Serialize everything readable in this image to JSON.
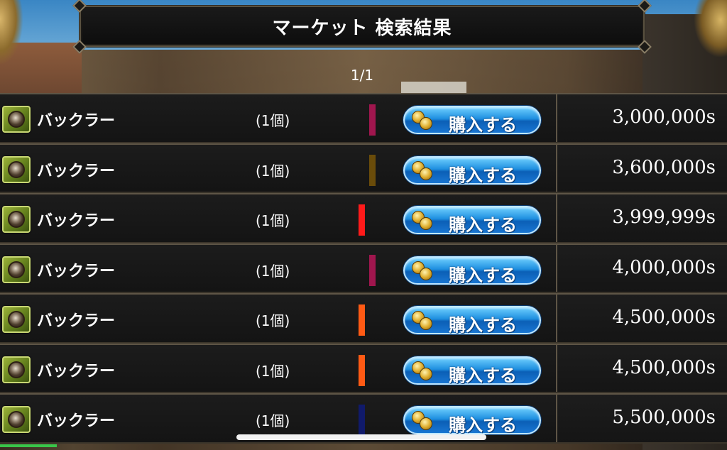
{
  "header": {
    "title": "マーケット  検索結果"
  },
  "pagination": {
    "label": "1/1"
  },
  "colors": {
    "buy_button": "#1f8fe0",
    "row_background": "#171717",
    "border": "#5e5546"
  },
  "listings": [
    {
      "icon": "buckler-shield-icon",
      "name": "バックラー",
      "quantity": "(1個)",
      "rarity_color": "#a0164e",
      "buy_label": "購入する",
      "price": "3,000,000s"
    },
    {
      "icon": "buckler-shield-icon",
      "name": "バックラー",
      "quantity": "(1個)",
      "rarity_color": "#6a4c0a",
      "buy_label": "購入する",
      "price": "3,600,000s"
    },
    {
      "icon": "buckler-shield-icon",
      "name": "バックラー",
      "quantity": "(1個)",
      "rarity_color": "#ff1a1a",
      "buy_label": "購入する",
      "price": "3,999,999s"
    },
    {
      "icon": "buckler-shield-icon",
      "name": "バックラー",
      "quantity": "(1個)",
      "rarity_color": "#a0164e",
      "buy_label": "購入する",
      "price": "4,000,000s"
    },
    {
      "icon": "buckler-shield-icon",
      "name": "バックラー",
      "quantity": "(1個)",
      "rarity_color": "#ff5a14",
      "buy_label": "購入する",
      "price": "4,500,000s"
    },
    {
      "icon": "buckler-shield-icon",
      "name": "バックラー",
      "quantity": "(1個)",
      "rarity_color": "#ff5a14",
      "buy_label": "購入する",
      "price": "4,500,000s"
    },
    {
      "icon": "buckler-shield-icon",
      "name": "バックラー",
      "quantity": "(1個)",
      "rarity_color": "#101a6a",
      "buy_label": "購入する",
      "price": "5,500,000s"
    }
  ]
}
